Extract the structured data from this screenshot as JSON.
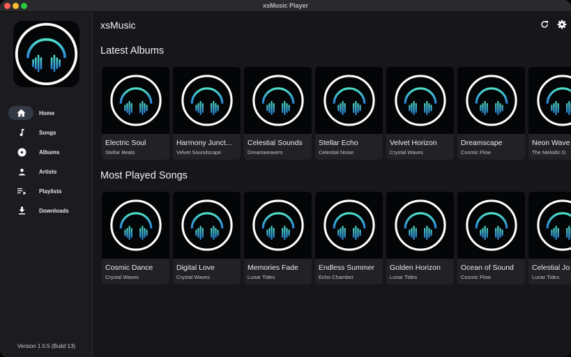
{
  "window": {
    "title": "xsMusic Player"
  },
  "sidebar": {
    "items": [
      {
        "label": "Home",
        "icon": "home-icon",
        "active": true
      },
      {
        "label": "Songs",
        "icon": "music-note-icon"
      },
      {
        "label": "Albums",
        "icon": "album-icon"
      },
      {
        "label": "Artists",
        "icon": "person-icon"
      },
      {
        "label": "Playlists",
        "icon": "playlist-icon"
      },
      {
        "label": "Downloads",
        "icon": "download-icon"
      }
    ],
    "version": "Version 1.0.5 (Build 13)"
  },
  "header": {
    "app_name": "xsMusic",
    "refresh_icon": "refresh-icon",
    "settings_icon": "gear-icon"
  },
  "sections": {
    "latest_albums": {
      "title": "Latest Albums",
      "items": [
        {
          "title": "Electric Soul",
          "subtitle": "Stellar Beats"
        },
        {
          "title": "Harmony Junct...",
          "subtitle": "Velvet Soundscape"
        },
        {
          "title": "Celestial Sounds",
          "subtitle": "Dreamweavers"
        },
        {
          "title": "Stellar Echo",
          "subtitle": "Celestial Noise"
        },
        {
          "title": "Velvet Horizon",
          "subtitle": "Crystal Waves"
        },
        {
          "title": "Dreamscape",
          "subtitle": "Cosmic Flow"
        },
        {
          "title": "Neon Wave",
          "subtitle": "The Melodic D"
        }
      ]
    },
    "most_played": {
      "title": "Most Played Songs",
      "items": [
        {
          "title": "Cosmic Dance",
          "subtitle": "Crystal Waves"
        },
        {
          "title": "Digital Love",
          "subtitle": "Crystal Waves"
        },
        {
          "title": "Memories Fade",
          "subtitle": "Lunar Tides"
        },
        {
          "title": "Endless Summer",
          "subtitle": "Echo Chamber"
        },
        {
          "title": "Golden Horizon",
          "subtitle": "Lunar Tides"
        },
        {
          "title": "Ocean of Sound",
          "subtitle": "Cosmic Flow"
        },
        {
          "title": "Celestial Jo",
          "subtitle": "Lunar Tides"
        }
      ]
    }
  },
  "colors": {
    "accent_teal": "#3fd0c9",
    "accent_blue": "#2a8fd6",
    "nav_active_bg": "#333a46"
  },
  "artwork_icon": "headphones-logo-icon"
}
